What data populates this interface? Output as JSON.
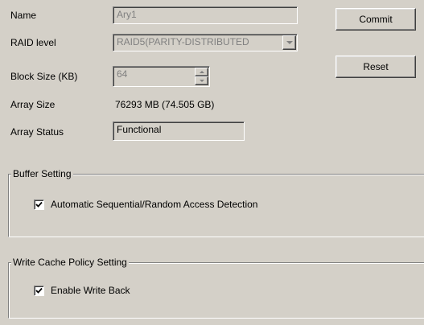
{
  "form": {
    "name_label": "Name",
    "name_value": "Ary1",
    "raid_label": "RAID level",
    "raid_value": "RAID5(PARITY-DISTRIBUTED",
    "block_label": "Block Size (KB)",
    "block_value": "64",
    "array_size_label": "Array Size",
    "array_size_value": "76293 MB (74.505 GB)",
    "array_status_label": "Array Status",
    "array_status_value": "Functional"
  },
  "buttons": {
    "commit_label": "Commit",
    "reset_label": "Reset"
  },
  "buffer_group": {
    "title": "Buffer Setting",
    "checkbox_label": "Automatic Sequential/Random Access Detection",
    "checked": true
  },
  "cache_group": {
    "title": "Write Cache Policy Setting",
    "checkbox_label": "Enable Write Back",
    "checked": true
  }
}
